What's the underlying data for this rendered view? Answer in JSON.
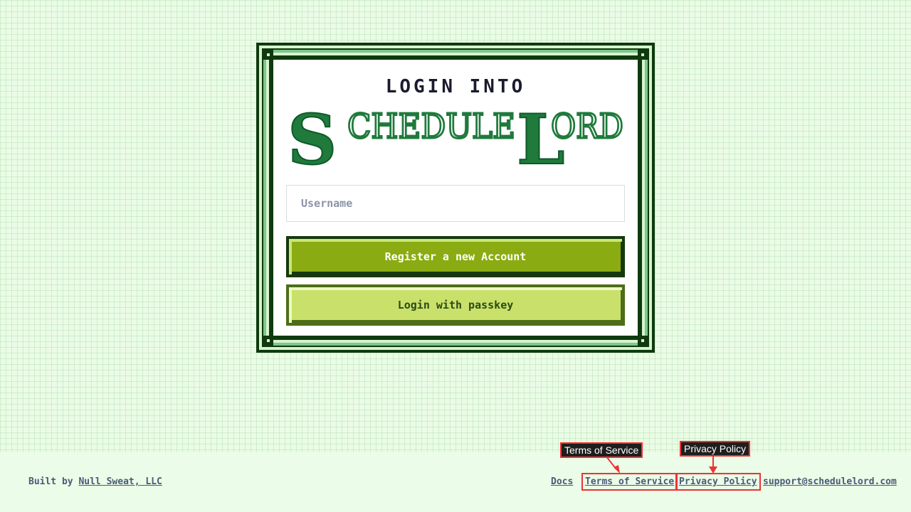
{
  "login": {
    "heading": "LOGIN INTO",
    "logo_text": "SCHEDULELORD",
    "username_placeholder": "Username",
    "username_value": "",
    "register_label": "Register a new Account",
    "passkey_label": "Login with passkey"
  },
  "footer": {
    "built_by_prefix": "Built by",
    "built_by_link": "Null Sweat, LLC",
    "links": [
      "Docs",
      "Terms of Service",
      "Privacy Policy",
      "support@schedulelord.com"
    ]
  },
  "callouts": {
    "terms": "Terms of Service",
    "privacy": "Privacy Policy"
  },
  "colors": {
    "frame_dark": "#0e3a0e",
    "logo_green": "#1f7a3c",
    "primary_button": "#8aab12",
    "secondary_button": "#c9e16b",
    "annotation_red": "#ee3333"
  }
}
